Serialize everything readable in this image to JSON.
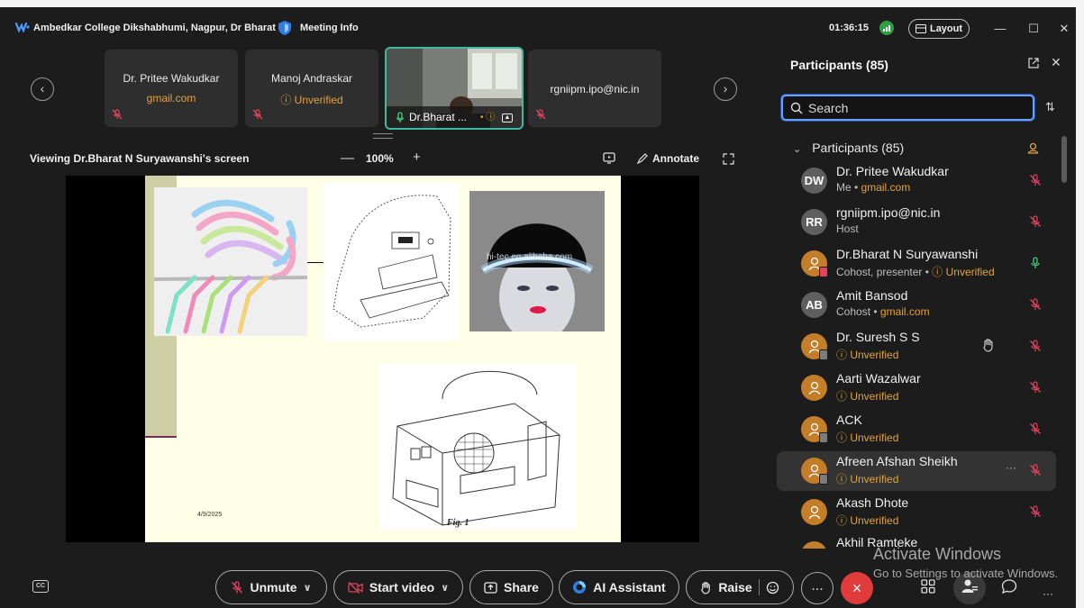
{
  "titlebar": {
    "meeting_title": "Ambedkar College Dikshabhumi, Nagpur, Dr Bharat",
    "meeting_info_label": "Meeting Info",
    "timer": "01:36:15",
    "layout_label": "Layout"
  },
  "filmstrip": {
    "tiles": [
      {
        "name": "Dr. Pritee Wakudkar",
        "sub": "gmail.com"
      },
      {
        "name": "Manoj Andraskar",
        "sub": "Unverified"
      },
      {
        "name": "Dr.Bharat ...",
        "sub": ""
      },
      {
        "name": "rgniipm.ipo@nic.in",
        "sub": ""
      }
    ]
  },
  "share": {
    "viewing_label": "Viewing Dr.Bharat N Suryawanshi's screen",
    "zoom_level": "100%",
    "annotate_label": "Annotate",
    "slide_date": "4/9/2025",
    "watermark": "hi-tec.en.alibaba.com",
    "fig_label": "Fig. 1"
  },
  "panel": {
    "title": "Participants (85)",
    "search_placeholder": "Search",
    "section_header": "Participants (85)",
    "participants": [
      {
        "name": "Dr. Pritee Wakudkar",
        "initials": "DW",
        "role": "Me",
        "detail": "gmail.com",
        "detail_warn": true,
        "mic": "muted"
      },
      {
        "name": "rgniipm.ipo@nic.in",
        "initials": "RR",
        "role": "Host",
        "detail": "",
        "detail_warn": false,
        "mic": "muted"
      },
      {
        "name": "Dr.Bharat N Suryawanshi",
        "initials": "",
        "role": "Cohost, presenter",
        "detail": "Unverified",
        "detail_warn": true,
        "mic": "on"
      },
      {
        "name": "Amit Bansod",
        "initials": "AB",
        "role": "Cohost",
        "detail": "gmail.com",
        "detail_warn": true,
        "mic": "muted"
      },
      {
        "name": "Dr. Suresh S S",
        "initials": "",
        "role": "",
        "detail": "Unverified",
        "detail_warn": true,
        "mic": "muted"
      },
      {
        "name": "Aarti Wazalwar",
        "initials": "",
        "role": "",
        "detail": "Unverified",
        "detail_warn": true,
        "mic": "muted"
      },
      {
        "name": "ACK",
        "initials": "",
        "role": "",
        "detail": "Unverified",
        "detail_warn": true,
        "mic": "muted"
      },
      {
        "name": "Afreen Afshan Sheikh",
        "initials": "",
        "role": "",
        "detail": "Unverified",
        "detail_warn": true,
        "mic": "muted"
      },
      {
        "name": "Akash Dhote",
        "initials": "",
        "role": "",
        "detail": "Unverified",
        "detail_warn": true,
        "mic": "muted"
      },
      {
        "name": "Akhil Ramteke",
        "initials": "",
        "role": "",
        "detail": "",
        "detail_warn": false,
        "mic": "muted"
      }
    ]
  },
  "controls": {
    "unmute": "Unmute",
    "start_video": "Start video",
    "share": "Share",
    "ai_assistant": "AI Assistant",
    "raise": "Raise",
    "more": "...",
    "end": "×"
  },
  "watermark": {
    "line1": "Activate Windows",
    "line2": "Go to Settings to activate Windows."
  },
  "colors": {
    "accent_blue": "#6aa0ff",
    "warning": "#e2a33a",
    "muted_red": "#e2435e",
    "end_call": "#e03a3a",
    "active_tile": "#3fb9a3"
  }
}
